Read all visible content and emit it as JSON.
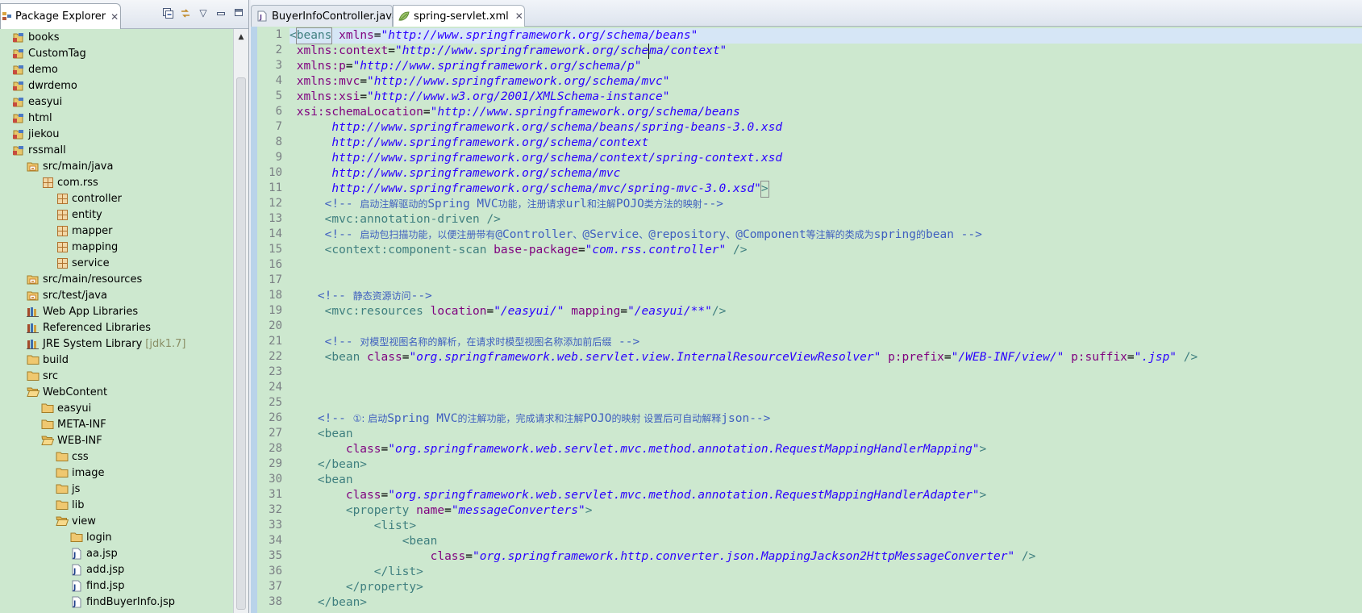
{
  "package_explorer": {
    "title": "Package Explorer",
    "tools": [
      "collapse-all-icon",
      "link-with-editor-icon",
      "view-menu-icon",
      "minimize-icon",
      "maximize-icon"
    ],
    "items": [
      {
        "label": "books",
        "depth": 0,
        "icon": "project-icon"
      },
      {
        "label": "CustomTag",
        "depth": 0,
        "icon": "project-icon"
      },
      {
        "label": "demo",
        "depth": 0,
        "icon": "project-icon"
      },
      {
        "label": "dwrdemo",
        "depth": 0,
        "icon": "project-icon"
      },
      {
        "label": "easyui",
        "depth": 0,
        "icon": "project-icon"
      },
      {
        "label": "html",
        "depth": 0,
        "icon": "project-icon"
      },
      {
        "label": "jiekou",
        "depth": 0,
        "icon": "project-icon"
      },
      {
        "label": "rssmall",
        "depth": 0,
        "icon": "project-icon"
      },
      {
        "label": "src/main/java",
        "depth": 1,
        "icon": "source-folder-icon"
      },
      {
        "label": "com.rss",
        "depth": 2,
        "icon": "package-icon"
      },
      {
        "label": "controller",
        "depth": 3,
        "icon": "package-icon"
      },
      {
        "label": "entity",
        "depth": 3,
        "icon": "package-icon"
      },
      {
        "label": "mapper",
        "depth": 3,
        "icon": "package-icon"
      },
      {
        "label": "mapping",
        "depth": 3,
        "icon": "package-icon"
      },
      {
        "label": "service",
        "depth": 3,
        "icon": "package-icon"
      },
      {
        "label": "src/main/resources",
        "depth": 1,
        "icon": "source-folder-icon"
      },
      {
        "label": "src/test/java",
        "depth": 1,
        "icon": "source-folder-icon"
      },
      {
        "label": "Web App Libraries",
        "depth": 1,
        "icon": "library-icon"
      },
      {
        "label": "Referenced Libraries",
        "depth": 1,
        "icon": "library-icon"
      },
      {
        "label": "JRE System Library",
        "decor": "[jdk1.7]",
        "depth": 1,
        "icon": "library-icon"
      },
      {
        "label": "build",
        "depth": 1,
        "icon": "folder-icon"
      },
      {
        "label": "src",
        "depth": 1,
        "icon": "folder-icon"
      },
      {
        "label": "WebContent",
        "depth": 1,
        "icon": "folder-open-icon"
      },
      {
        "label": "easyui",
        "depth": 2,
        "icon": "folder-icon"
      },
      {
        "label": "META-INF",
        "depth": 2,
        "icon": "folder-icon"
      },
      {
        "label": "WEB-INF",
        "depth": 2,
        "icon": "folder-open-icon"
      },
      {
        "label": "css",
        "depth": 3,
        "icon": "folder-icon"
      },
      {
        "label": "image",
        "depth": 3,
        "icon": "folder-icon"
      },
      {
        "label": "js",
        "depth": 3,
        "icon": "folder-icon"
      },
      {
        "label": "lib",
        "depth": 3,
        "icon": "folder-icon"
      },
      {
        "label": "view",
        "depth": 3,
        "icon": "folder-open-icon"
      },
      {
        "label": "login",
        "depth": 4,
        "icon": "folder-icon"
      },
      {
        "label": "aa.jsp",
        "depth": 4,
        "icon": "jsp-file-icon"
      },
      {
        "label": "add.jsp",
        "depth": 4,
        "icon": "jsp-file-icon"
      },
      {
        "label": "find.jsp",
        "depth": 4,
        "icon": "jsp-file-icon"
      },
      {
        "label": "findBuyerInfo.jsp",
        "depth": 4,
        "icon": "jsp-file-icon"
      }
    ]
  },
  "editor": {
    "tabs": [
      {
        "label": "BuyerInfoController.java",
        "icon": "java-file-icon",
        "active": false
      },
      {
        "label": "spring-servlet.xml",
        "icon": "xml-file-icon",
        "active": true
      }
    ],
    "lines": [
      {
        "n": "1",
        "tokens": [
          [
            "tag",
            "<"
          ],
          [
            "tag",
            "beans",
            "box"
          ],
          [
            "txt",
            " "
          ],
          [
            "attr",
            "xmlns"
          ],
          [
            "txt",
            "="
          ],
          [
            "val",
            "\"http://www.springframework.org/schema/beans\""
          ]
        ]
      },
      {
        "n": "2",
        "tokens": [
          [
            "txt",
            " "
          ],
          [
            "attr",
            "xmlns:context"
          ],
          [
            "txt",
            "="
          ],
          [
            "val",
            "\"http://www.springframework.org/sche"
          ],
          [
            "val",
            "m",
            "cursor"
          ],
          [
            "val",
            "a/context\""
          ]
        ]
      },
      {
        "n": "3",
        "tokens": [
          [
            "txt",
            " "
          ],
          [
            "attr",
            "xmlns:p"
          ],
          [
            "txt",
            "="
          ],
          [
            "val",
            "\"http://www.springframework.org/schema/p\""
          ]
        ]
      },
      {
        "n": "4",
        "tokens": [
          [
            "txt",
            " "
          ],
          [
            "attr",
            "xmlns:mvc"
          ],
          [
            "txt",
            "="
          ],
          [
            "val",
            "\"http://www.springframework.org/schema/mvc\""
          ]
        ]
      },
      {
        "n": "5",
        "tokens": [
          [
            "txt",
            " "
          ],
          [
            "attr",
            "xmlns:xsi"
          ],
          [
            "txt",
            "="
          ],
          [
            "val",
            "\"http://www.w3.org/2001/XMLSchema-instance\""
          ]
        ]
      },
      {
        "n": "6",
        "tokens": [
          [
            "txt",
            " "
          ],
          [
            "attr",
            "xsi:schemaLocation"
          ],
          [
            "txt",
            "="
          ],
          [
            "val",
            "\"http://www.springframework.org/schema/beans"
          ]
        ]
      },
      {
        "n": "7",
        "tokens": [
          [
            "txt",
            "      "
          ],
          [
            "val",
            "http://www.springframework.org/schema/beans/spring-beans-3.0.xsd"
          ]
        ]
      },
      {
        "n": "8",
        "tokens": [
          [
            "txt",
            "      "
          ],
          [
            "val",
            "http://www.springframework.org/schema/context"
          ]
        ]
      },
      {
        "n": "9",
        "tokens": [
          [
            "txt",
            "      "
          ],
          [
            "val",
            "http://www.springframework.org/schema/context/spring-context.xsd"
          ]
        ]
      },
      {
        "n": "10",
        "tokens": [
          [
            "txt",
            "      "
          ],
          [
            "val",
            "http://www.springframework.org/schema/mvc"
          ]
        ]
      },
      {
        "n": "11",
        "tokens": [
          [
            "txt",
            "      "
          ],
          [
            "val",
            "http://www.springframework.org/schema/mvc/spring-mvc-3.0.xsd\""
          ],
          [
            "tag",
            ">",
            "box"
          ]
        ]
      },
      {
        "n": "12",
        "tokens": [
          [
            "txt",
            "     "
          ],
          [
            "com",
            "<!-- "
          ],
          [
            "com",
            "启动注解驱动的",
            "cjk"
          ],
          [
            "com",
            "Spring MVC"
          ],
          [
            "com",
            "功能，注册请求",
            "cjk"
          ],
          [
            "com",
            "url"
          ],
          [
            "com",
            "和注解",
            "cjk"
          ],
          [
            "com",
            "POJO"
          ],
          [
            "com",
            "类方法的映射",
            "cjk"
          ],
          [
            "com",
            "-->"
          ]
        ]
      },
      {
        "n": "13",
        "tokens": [
          [
            "txt",
            "     "
          ],
          [
            "tag",
            "<mvc:annotation-driven />"
          ]
        ]
      },
      {
        "n": "14",
        "tokens": [
          [
            "txt",
            "     "
          ],
          [
            "com",
            "<!-- "
          ],
          [
            "com",
            "启动包扫描功能，以便注册带有",
            "cjk"
          ],
          [
            "com",
            "@Controller"
          ],
          [
            "com",
            "、",
            "cjk"
          ],
          [
            "com",
            "@Service"
          ],
          [
            "com",
            "、",
            "cjk"
          ],
          [
            "com",
            "@repository"
          ],
          [
            "com",
            "、",
            "cjk"
          ],
          [
            "com",
            "@Component"
          ],
          [
            "com",
            "等注解的类成为",
            "cjk"
          ],
          [
            "com",
            "spring"
          ],
          [
            "com",
            "的",
            "cjk"
          ],
          [
            "com",
            "bean -->"
          ]
        ]
      },
      {
        "n": "15",
        "tokens": [
          [
            "txt",
            "     "
          ],
          [
            "tag",
            "<context:component-scan "
          ],
          [
            "attr",
            "base-package"
          ],
          [
            "txt",
            "="
          ],
          [
            "val",
            "\"com.rss.controller\""
          ],
          [
            "tag",
            " />"
          ]
        ]
      },
      {
        "n": "16",
        "tokens": []
      },
      {
        "n": "17",
        "tokens": []
      },
      {
        "n": "18",
        "tokens": [
          [
            "txt",
            "    "
          ],
          [
            "com",
            "<!-- "
          ],
          [
            "com",
            "静态资源访问",
            "cjk"
          ],
          [
            "com",
            "-->"
          ]
        ]
      },
      {
        "n": "19",
        "tokens": [
          [
            "txt",
            "     "
          ],
          [
            "tag",
            "<mvc:resources "
          ],
          [
            "attr",
            "location"
          ],
          [
            "txt",
            "="
          ],
          [
            "val",
            "\"/easyui/\""
          ],
          [
            "txt",
            " "
          ],
          [
            "attr",
            "mapping"
          ],
          [
            "txt",
            "="
          ],
          [
            "val",
            "\"/easyui/**\""
          ],
          [
            "tag",
            "/>"
          ]
        ]
      },
      {
        "n": "20",
        "tokens": []
      },
      {
        "n": "21",
        "tokens": [
          [
            "txt",
            "     "
          ],
          [
            "com",
            "<!-- "
          ],
          [
            "com",
            "对模型视图名称的解析，在请求时模型视图名称添加前后缀",
            "cjk"
          ],
          [
            "com",
            " -->"
          ]
        ]
      },
      {
        "n": "22",
        "tokens": [
          [
            "txt",
            "     "
          ],
          [
            "tag",
            "<bean "
          ],
          [
            "attr",
            "class"
          ],
          [
            "txt",
            "="
          ],
          [
            "val",
            "\"org.springframework.web.servlet.view.InternalResourceViewResolver\""
          ],
          [
            "txt",
            " "
          ],
          [
            "attr",
            "p:prefix"
          ],
          [
            "txt",
            "="
          ],
          [
            "val",
            "\"/WEB-INF/view/\""
          ],
          [
            "txt",
            " "
          ],
          [
            "attr",
            "p:suffix"
          ],
          [
            "txt",
            "="
          ],
          [
            "val",
            "\".jsp\""
          ],
          [
            "tag",
            " />"
          ]
        ]
      },
      {
        "n": "23",
        "tokens": []
      },
      {
        "n": "24",
        "tokens": []
      },
      {
        "n": "25",
        "tokens": []
      },
      {
        "n": "26",
        "tokens": [
          [
            "txt",
            "    "
          ],
          [
            "com",
            "<!-- "
          ],
          [
            "com",
            "①: 启动",
            "cjk"
          ],
          [
            "com",
            "Spring MVC"
          ],
          [
            "com",
            "的注解功能，完成请求和注解",
            "cjk"
          ],
          [
            "com",
            "POJO"
          ],
          [
            "com",
            "的映射 设置后可自动解释",
            "cjk"
          ],
          [
            "com",
            "json-->"
          ]
        ]
      },
      {
        "n": "27",
        "tokens": [
          [
            "txt",
            "    "
          ],
          [
            "tag",
            "<bean"
          ]
        ]
      },
      {
        "n": "28",
        "tokens": [
          [
            "txt",
            "        "
          ],
          [
            "attr",
            "class"
          ],
          [
            "txt",
            "="
          ],
          [
            "val",
            "\"org.springframework.web.servlet.mvc.method.annotation.RequestMappingHandlerMapping\""
          ],
          [
            "tag",
            ">"
          ]
        ]
      },
      {
        "n": "29",
        "tokens": [
          [
            "txt",
            "    "
          ],
          [
            "tag",
            "</bean>"
          ]
        ]
      },
      {
        "n": "30",
        "tokens": [
          [
            "txt",
            "    "
          ],
          [
            "tag",
            "<bean"
          ]
        ]
      },
      {
        "n": "31",
        "tokens": [
          [
            "txt",
            "        "
          ],
          [
            "attr",
            "class"
          ],
          [
            "txt",
            "="
          ],
          [
            "val",
            "\"org.springframework.web.servlet.mvc.method.annotation.RequestMappingHandlerAdapter\""
          ],
          [
            "tag",
            ">"
          ]
        ]
      },
      {
        "n": "32",
        "tokens": [
          [
            "txt",
            "        "
          ],
          [
            "tag",
            "<property "
          ],
          [
            "attr",
            "name"
          ],
          [
            "txt",
            "="
          ],
          [
            "val",
            "\"messageConverters\""
          ],
          [
            "tag",
            ">"
          ]
        ]
      },
      {
        "n": "33",
        "tokens": [
          [
            "txt",
            "            "
          ],
          [
            "tag",
            "<list>"
          ]
        ]
      },
      {
        "n": "34",
        "tokens": [
          [
            "txt",
            "                "
          ],
          [
            "tag",
            "<bean"
          ]
        ]
      },
      {
        "n": "35",
        "tokens": [
          [
            "txt",
            "                    "
          ],
          [
            "attr",
            "class"
          ],
          [
            "txt",
            "="
          ],
          [
            "val",
            "\"org.springframework.http.converter.json.MappingJackson2HttpMessageConverter\""
          ],
          [
            "tag",
            " />"
          ]
        ]
      },
      {
        "n": "36",
        "tokens": [
          [
            "txt",
            "            "
          ],
          [
            "tag",
            "</list>"
          ]
        ]
      },
      {
        "n": "37",
        "tokens": [
          [
            "txt",
            "        "
          ],
          [
            "tag",
            "</property>"
          ]
        ]
      },
      {
        "n": "38",
        "tokens": [
          [
            "txt",
            "    "
          ],
          [
            "tag",
            "</bean>"
          ]
        ]
      }
    ]
  }
}
